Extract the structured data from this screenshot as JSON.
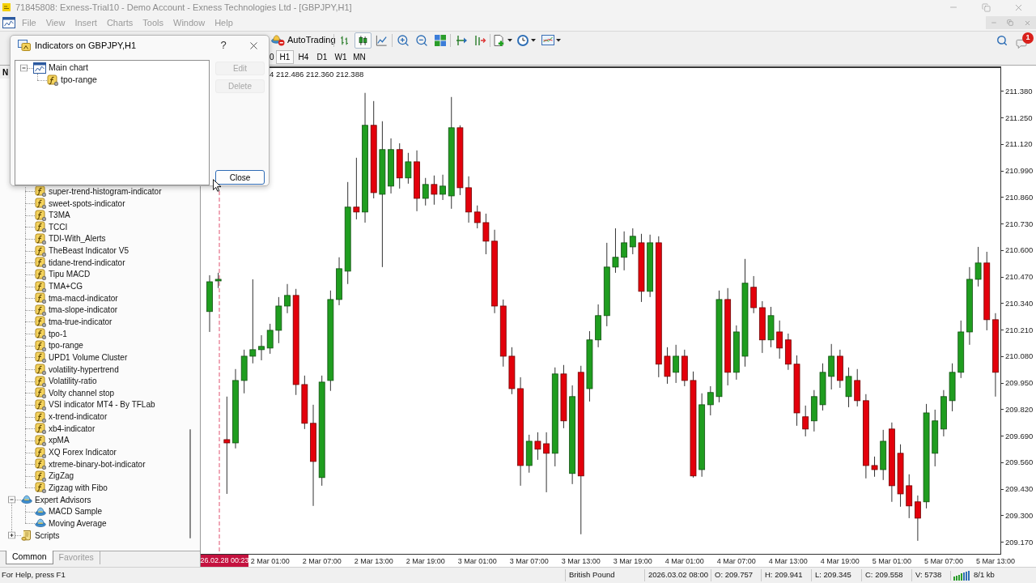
{
  "window": {
    "title": "71845808: Exness-Trial10 - Demo Account - Exness Technologies Ltd - [GBPJPY,H1]"
  },
  "menu": [
    "File",
    "View",
    "Insert",
    "Charts",
    "Tools",
    "Window",
    "Help"
  ],
  "toolbar": {
    "autotrading": "AutoTrading",
    "chart_types": [
      {
        "kind": "bars",
        "selected": false
      },
      {
        "kind": "candles",
        "selected": true
      },
      {
        "kind": "line",
        "selected": false
      }
    ],
    "notification_badge": "1"
  },
  "periods": [
    {
      "label": "0",
      "selected": false
    },
    {
      "label": "H1",
      "selected": true
    },
    {
      "label": "H4",
      "selected": false
    },
    {
      "label": "D1",
      "selected": false
    },
    {
      "label": "W1",
      "selected": false
    },
    {
      "label": "MN",
      "selected": false
    }
  ],
  "navigator": {
    "title": "N",
    "tree": [
      {
        "children": [
          {
            "label": "super-trend-histogram-indicator",
            "kind": "indicator"
          },
          {
            "label": "sweet-spots-indicator",
            "kind": "indicator"
          },
          {
            "label": "T3MA",
            "kind": "indicator"
          },
          {
            "label": "TCCI",
            "kind": "indicator"
          },
          {
            "label": "TDI-With_Alerts",
            "kind": "indicator"
          },
          {
            "label": "TheBeast Indicator V5",
            "kind": "indicator"
          },
          {
            "label": "tidane-trend-indicator",
            "kind": "indicator"
          },
          {
            "label": "Tipu MACD",
            "kind": "indicator"
          },
          {
            "label": "TMA+CG",
            "kind": "indicator"
          },
          {
            "label": "tma-macd-indicator",
            "kind": "indicator"
          },
          {
            "label": "tma-slope-indicator",
            "kind": "indicator"
          },
          {
            "label": "tma-true-indicator",
            "kind": "indicator"
          },
          {
            "label": "tpo-1",
            "kind": "indicator"
          },
          {
            "label": "tpo-range",
            "kind": "indicator"
          },
          {
            "label": "UPD1 Volume Cluster",
            "kind": "indicator"
          },
          {
            "label": "volatility-hypertrend",
            "kind": "indicator"
          },
          {
            "label": "Volatility-ratio",
            "kind": "indicator"
          },
          {
            "label": "Volty channel stop",
            "kind": "indicator"
          },
          {
            "label": "VSI indicator MT4 - By TFLab",
            "kind": "indicator"
          },
          {
            "label": "x-trend-indicator",
            "kind": "indicator"
          },
          {
            "label": "xb4-indicator",
            "kind": "indicator"
          },
          {
            "label": "xpMA",
            "kind": "indicator"
          },
          {
            "label": "XQ Forex Indicator",
            "kind": "indicator"
          },
          {
            "label": "xtreme-binary-bot-indicator",
            "kind": "indicator"
          },
          {
            "label": "ZigZag",
            "kind": "indicator"
          },
          {
            "label": "Zigzag with Fibo",
            "kind": "indicator"
          }
        ]
      },
      {
        "label": "Expert Advisors",
        "kind": "experts",
        "expanded": true,
        "children": [
          {
            "label": "MACD Sample",
            "kind": "expert"
          },
          {
            "label": "Moving Average",
            "kind": "expert"
          }
        ]
      },
      {
        "label": "Scripts",
        "kind": "scripts",
        "expanded": false
      }
    ],
    "tabs": [
      {
        "label": "Common",
        "selected": true
      },
      {
        "label": "Favorites",
        "selected": false
      }
    ]
  },
  "chart": {
    "header": "4 212.486 212.360 212.388",
    "time_marker": "26.02.28 00:23",
    "chart_data": {
      "type": "candlestick",
      "categories": [
        null,
        null,
        null,
        null,
        null,
        null,
        null,
        "2 Mar 01:00",
        null,
        null,
        null,
        null,
        null,
        "2 Mar 07:00",
        null,
        null,
        null,
        null,
        null,
        "2 Mar 13:00",
        null,
        null,
        null,
        null,
        null,
        "2 Mar 19:00",
        null,
        null,
        null,
        null,
        null,
        "3 Mar 01:00",
        null,
        null,
        null,
        null,
        null,
        "3 Mar 07:00",
        null,
        null,
        null,
        null,
        null,
        "3 Mar 13:00",
        null,
        null,
        null,
        null,
        null,
        "3 Mar 19:00",
        null,
        null,
        null,
        null,
        null,
        "4 Mar 01:00",
        null,
        null,
        null,
        null,
        null,
        "4 Mar 07:00",
        null,
        null,
        null,
        null,
        null,
        "4 Mar 13:00",
        null,
        null,
        null,
        null,
        null,
        "4 Mar 19:00",
        null,
        null,
        null,
        null,
        null,
        "5 Mar 01:00",
        null,
        null,
        null,
        null,
        null,
        "5 Mar 07:00",
        null,
        null,
        null,
        null,
        null,
        "5 Mar 13:00"
      ],
      "ohlc": [
        [
          210.301,
          210.479,
          210.201,
          210.447
        ],
        [
          210.451,
          210.491,
          210.416,
          210.459
        ],
        [
          209.673,
          209.884,
          209.407,
          209.657
        ],
        [
          209.657,
          210.019,
          209.63,
          209.963
        ],
        [
          209.963,
          210.114,
          209.9,
          210.082
        ],
        [
          210.082,
          210.459,
          210.047,
          210.114
        ],
        [
          210.114,
          210.185,
          210.062,
          210.13
        ],
        [
          210.122,
          210.241,
          210.094,
          210.209
        ],
        [
          210.209,
          210.372,
          210.146,
          210.328
        ],
        [
          210.328,
          210.436,
          210.293,
          210.38
        ],
        [
          210.38,
          210.412,
          209.892,
          209.943
        ],
        [
          209.943,
          209.987,
          209.725,
          209.753
        ],
        [
          209.753,
          209.844,
          209.348,
          209.566
        ],
        [
          209.487,
          209.987,
          209.447,
          209.955
        ],
        [
          209.963,
          210.404,
          209.912,
          210.36
        ],
        [
          210.36,
          210.567,
          210.332,
          210.511
        ],
        [
          210.499,
          210.936,
          210.436,
          210.813
        ],
        [
          210.813,
          211.055,
          210.753,
          210.789
        ],
        [
          210.789,
          211.373,
          210.737,
          211.214
        ],
        [
          211.214,
          211.333,
          210.856,
          210.884
        ],
        [
          210.876,
          211.234,
          210.519,
          211.095
        ],
        [
          210.916,
          211.15,
          210.88,
          211.095
        ],
        [
          211.095,
          211.126,
          210.904,
          210.956
        ],
        [
          210.956,
          211.079,
          210.928,
          211.035
        ],
        [
          211.035,
          211.091,
          210.793,
          210.856
        ],
        [
          210.856,
          210.956,
          210.821,
          210.924
        ],
        [
          210.924,
          210.968,
          210.825,
          210.876
        ],
        [
          210.876,
          210.972,
          210.848,
          210.916
        ],
        [
          210.868,
          211.353,
          210.805,
          211.202
        ],
        [
          211.202,
          211.214,
          210.872,
          210.908
        ],
        [
          210.908,
          210.964,
          210.737,
          210.789
        ],
        [
          210.789,
          210.821,
          210.709,
          210.737
        ],
        [
          210.737,
          210.781,
          210.582,
          210.646
        ],
        [
          210.646,
          210.702,
          210.293,
          210.328
        ],
        [
          210.328,
          210.36,
          210.031,
          210.082
        ],
        [
          210.082,
          210.126,
          209.896,
          209.923
        ],
        [
          209.923,
          209.979,
          209.447,
          209.546
        ],
        [
          209.546,
          209.697,
          209.511,
          209.665
        ],
        [
          209.665,
          209.709,
          209.574,
          209.626
        ],
        [
          209.653,
          209.709,
          209.415,
          209.606
        ],
        [
          209.606,
          210.027,
          209.542,
          209.995
        ],
        [
          209.995,
          210.039,
          209.729,
          209.765
        ],
        [
          209.507,
          209.939,
          209.455,
          209.884
        ],
        [
          210.003,
          210.035,
          209.209,
          209.495
        ],
        [
          209.923,
          210.205,
          209.86,
          210.162
        ],
        [
          210.162,
          210.336,
          210.126,
          210.281
        ],
        [
          210.281,
          210.638,
          210.229,
          210.519
        ],
        [
          210.519,
          210.709,
          210.491,
          210.567
        ],
        [
          210.567,
          210.694,
          210.503,
          210.638
        ],
        [
          210.618,
          210.709,
          210.582,
          210.67
        ],
        [
          210.638,
          210.682,
          210.348,
          210.4
        ],
        [
          210.4,
          210.678,
          210.372,
          210.638
        ],
        [
          210.638,
          210.67,
          209.979,
          210.043
        ],
        [
          210.082,
          210.126,
          209.947,
          209.983
        ],
        [
          210.003,
          210.138,
          209.951,
          210.082
        ],
        [
          210.082,
          210.114,
          209.935,
          209.963
        ],
        [
          209.963,
          210.007,
          209.487,
          209.495
        ],
        [
          209.526,
          209.9,
          209.491,
          209.844
        ],
        [
          209.844,
          209.935,
          209.792,
          209.904
        ],
        [
          209.884,
          210.404,
          209.856,
          210.36
        ],
        [
          210.36,
          210.416,
          209.939,
          210.003
        ],
        [
          210.003,
          210.233,
          209.967,
          210.201
        ],
        [
          210.082,
          210.559,
          210.031,
          210.44
        ],
        [
          210.42,
          210.475,
          210.293,
          210.32
        ],
        [
          210.32,
          210.352,
          210.098,
          210.162
        ],
        [
          210.162,
          210.324,
          210.126,
          210.281
        ],
        [
          210.201,
          210.257,
          210.07,
          210.122
        ],
        [
          210.162,
          210.193,
          210.015,
          210.043
        ],
        [
          210.043,
          210.086,
          209.741,
          209.804
        ],
        [
          209.785,
          209.84,
          209.689,
          209.725
        ],
        [
          209.765,
          209.916,
          209.713,
          209.884
        ],
        [
          209.844,
          210.047,
          209.816,
          210.003
        ],
        [
          209.983,
          210.142,
          209.919,
          210.082
        ],
        [
          210.082,
          210.114,
          209.927,
          209.963
        ],
        [
          209.884,
          210.027,
          209.832,
          209.983
        ],
        [
          209.963,
          210.019,
          209.836,
          209.864
        ],
        [
          209.864,
          209.896,
          209.483,
          209.546
        ],
        [
          209.546,
          209.59,
          209.491,
          209.526
        ],
        [
          209.526,
          209.721,
          209.475,
          209.665
        ],
        [
          209.725,
          209.757,
          209.368,
          209.447
        ],
        [
          209.606,
          209.65,
          209.344,
          209.407
        ],
        [
          209.447,
          209.503,
          209.288,
          209.348
        ],
        [
          209.368,
          209.399,
          209.177,
          209.288
        ],
        [
          209.368,
          209.848,
          209.336,
          209.804
        ],
        [
          209.606,
          209.82,
          209.542,
          209.765
        ],
        [
          209.725,
          209.916,
          209.689,
          209.884
        ],
        [
          209.864,
          210.047,
          209.812,
          210.003
        ],
        [
          210.003,
          210.257,
          209.975,
          210.201
        ],
        [
          210.201,
          210.519,
          210.138,
          210.459
        ],
        [
          210.459,
          210.618,
          210.424,
          210.539
        ],
        [
          210.539,
          210.594,
          210.209,
          210.261
        ],
        [
          210.261,
          210.293,
          209.884,
          210.003
        ]
      ],
      "ylim": [
        209.113,
        211.495
      ],
      "yticks": [
        {
          "value": 211.38,
          "label": "211.380"
        },
        {
          "value": 211.25,
          "label": "211.250"
        },
        {
          "value": 211.12,
          "label": "211.120"
        },
        {
          "value": 210.99,
          "label": "210.990"
        },
        {
          "value": 210.86,
          "label": "210.860"
        },
        {
          "value": 210.73,
          "label": "210.730"
        },
        {
          "value": 210.6,
          "label": "210.600"
        },
        {
          "value": 210.47,
          "label": "210.470"
        },
        {
          "value": 210.34,
          "label": "210.340"
        },
        {
          "value": 210.21,
          "label": "210.210"
        },
        {
          "value": 210.08,
          "label": "210.080"
        },
        {
          "value": 209.95,
          "label": "209.950"
        },
        {
          "value": 209.82,
          "label": "209.820"
        },
        {
          "value": 209.69,
          "label": "209.690"
        },
        {
          "value": 209.56,
          "label": "209.560"
        },
        {
          "value": 209.43,
          "label": "209.430"
        },
        {
          "value": 209.3,
          "label": "209.300"
        },
        {
          "value": 209.17,
          "label": "209.170"
        }
      ]
    }
  },
  "dialog": {
    "title": "Indicators on GBPJPY,H1",
    "help": "?",
    "tree": [
      {
        "label": "Main chart",
        "kind": "chart",
        "expanded": true,
        "children": [
          {
            "label": "tpo-range",
            "kind": "indicator"
          }
        ]
      }
    ],
    "buttons": [
      {
        "label": "Edit",
        "disabled": true,
        "focused": false
      },
      {
        "label": "Delete",
        "disabled": true,
        "focused": false
      },
      {
        "label": "Close",
        "disabled": false,
        "focused": true
      }
    ]
  },
  "status_bar": {
    "help": "For Help, press F1",
    "symbol": "British Pound",
    "time": "2026.03.02 08:00",
    "open": "O: 209.757",
    "high": "H: 209.941",
    "low": "L: 209.345",
    "close": "C: 209.558",
    "volume": "V: 5738",
    "traffic": "8/1 kb"
  }
}
